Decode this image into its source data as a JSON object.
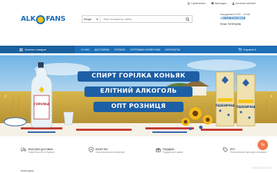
{
  "topbar": {
    "compare": "Сравнение",
    "wishlist": "Закладки",
    "account": "Личный кабинет"
  },
  "logo": {
    "left": "ALK",
    "right": "FANS"
  },
  "search": {
    "category": "Везде",
    "placeholder": "Текст поиска по сайту"
  },
  "contacts": {
    "hours": "Ежедневно 9:00 - 19:00",
    "phone": "+380984350328",
    "hint": "Наш телеграм"
  },
  "nav": {
    "catalog": "Каталог товаров",
    "items": [
      "О нас",
      "Доставка",
      "Оплата",
      "Оптовым клиентам",
      "Контакты"
    ],
    "cart": "Корзина 0"
  },
  "banner": {
    "line1": "СПИРТ ГОРІЛКА КОНЬЯК",
    "line2": "ЕЛІТНИЙ АЛКОГОЛЬ",
    "line3": "ОПТ РОЗНИЦЯ",
    "bottle_label": "ГОРІЛКА",
    "box_label": "ПШЕНИЧНА"
  },
  "features": [
    {
      "title": "Быстрая доставка",
      "subtitle": "Новой почтой по Украине",
      "icon": "truck-icon"
    },
    {
      "title": "Качество",
      "subtitle": "Гарантия высокого качества",
      "icon": "shield-icon"
    },
    {
      "title": "Подарки",
      "subtitle": "Подарки при заказе",
      "icon": "gift-icon"
    },
    {
      "title": "Опт",
      "subtitle": "Персональные цены для оптовиков",
      "icon": "tag-icon"
    }
  ],
  "section_title": "Категории",
  "watermark": "seoraport.ua",
  "colors": {
    "brand_blue": "#1d6fb8",
    "accent_yellow": "#f5c518",
    "fab_orange": "#f07a4a"
  }
}
